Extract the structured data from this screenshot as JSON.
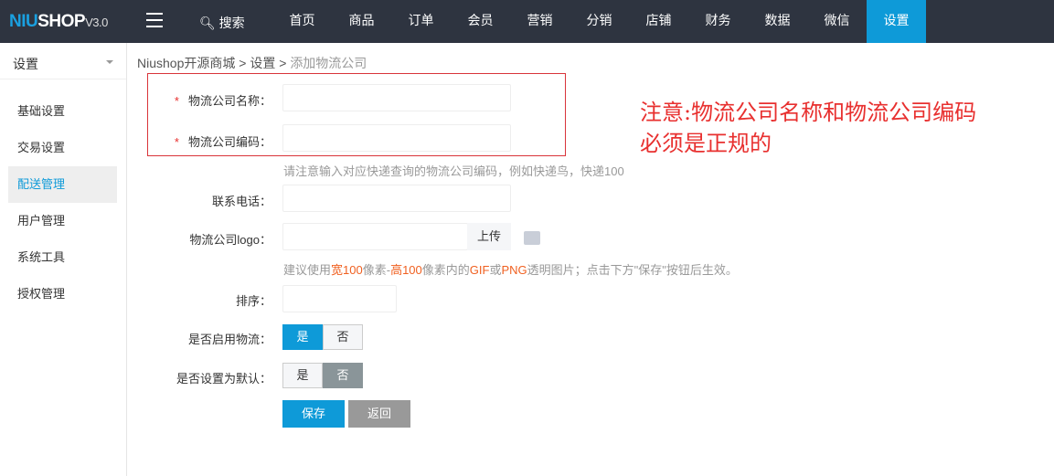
{
  "header": {
    "logo_a": "NIU",
    "logo_b": "SHOP",
    "logo_v": "V3.0",
    "search": "搜索",
    "nav": [
      "首页",
      "商品",
      "订单",
      "会员",
      "营销",
      "分销",
      "店铺",
      "财务",
      "数据",
      "微信",
      "设置"
    ],
    "active_nav": 10
  },
  "sidebar": {
    "title": "设置",
    "items": [
      "基础设置",
      "交易设置",
      "配送管理",
      "用户管理",
      "系统工具",
      "授权管理"
    ],
    "active": 2
  },
  "breadcrumb": [
    "Niushop开源商城",
    "设置",
    "添加物流公司"
  ],
  "annotation": {
    "line1": "注意:物流公司名称和物流公司编码",
    "line2": "必须是正规的"
  },
  "form": {
    "name_label": "物流公司名称：",
    "code_label": "物流公司编码：",
    "required_mark": "*",
    "code_hint": "请注意输入对应快递查询的物流公司编码，例如快递鸟，快递100",
    "phone_label": "联系电话：",
    "logo_label": "物流公司logo：",
    "upload": "上传",
    "logo_hint": [
      "建议使用",
      "宽100",
      "像素-",
      "高100",
      "像素内的",
      "GIF",
      "或",
      "PNG",
      "透明图片；点击下方\"保存\"按钮后生效。"
    ],
    "sort_label": "排序：",
    "enable_label": "是否启用物流：",
    "default_label": "是否设置为默认：",
    "yes": "是",
    "no": "否",
    "enable_value": "是",
    "default_value": "否",
    "save": "保存",
    "back": "返回"
  },
  "colors": {
    "accent": "#0e9ad8",
    "warning": "#e8302f"
  }
}
